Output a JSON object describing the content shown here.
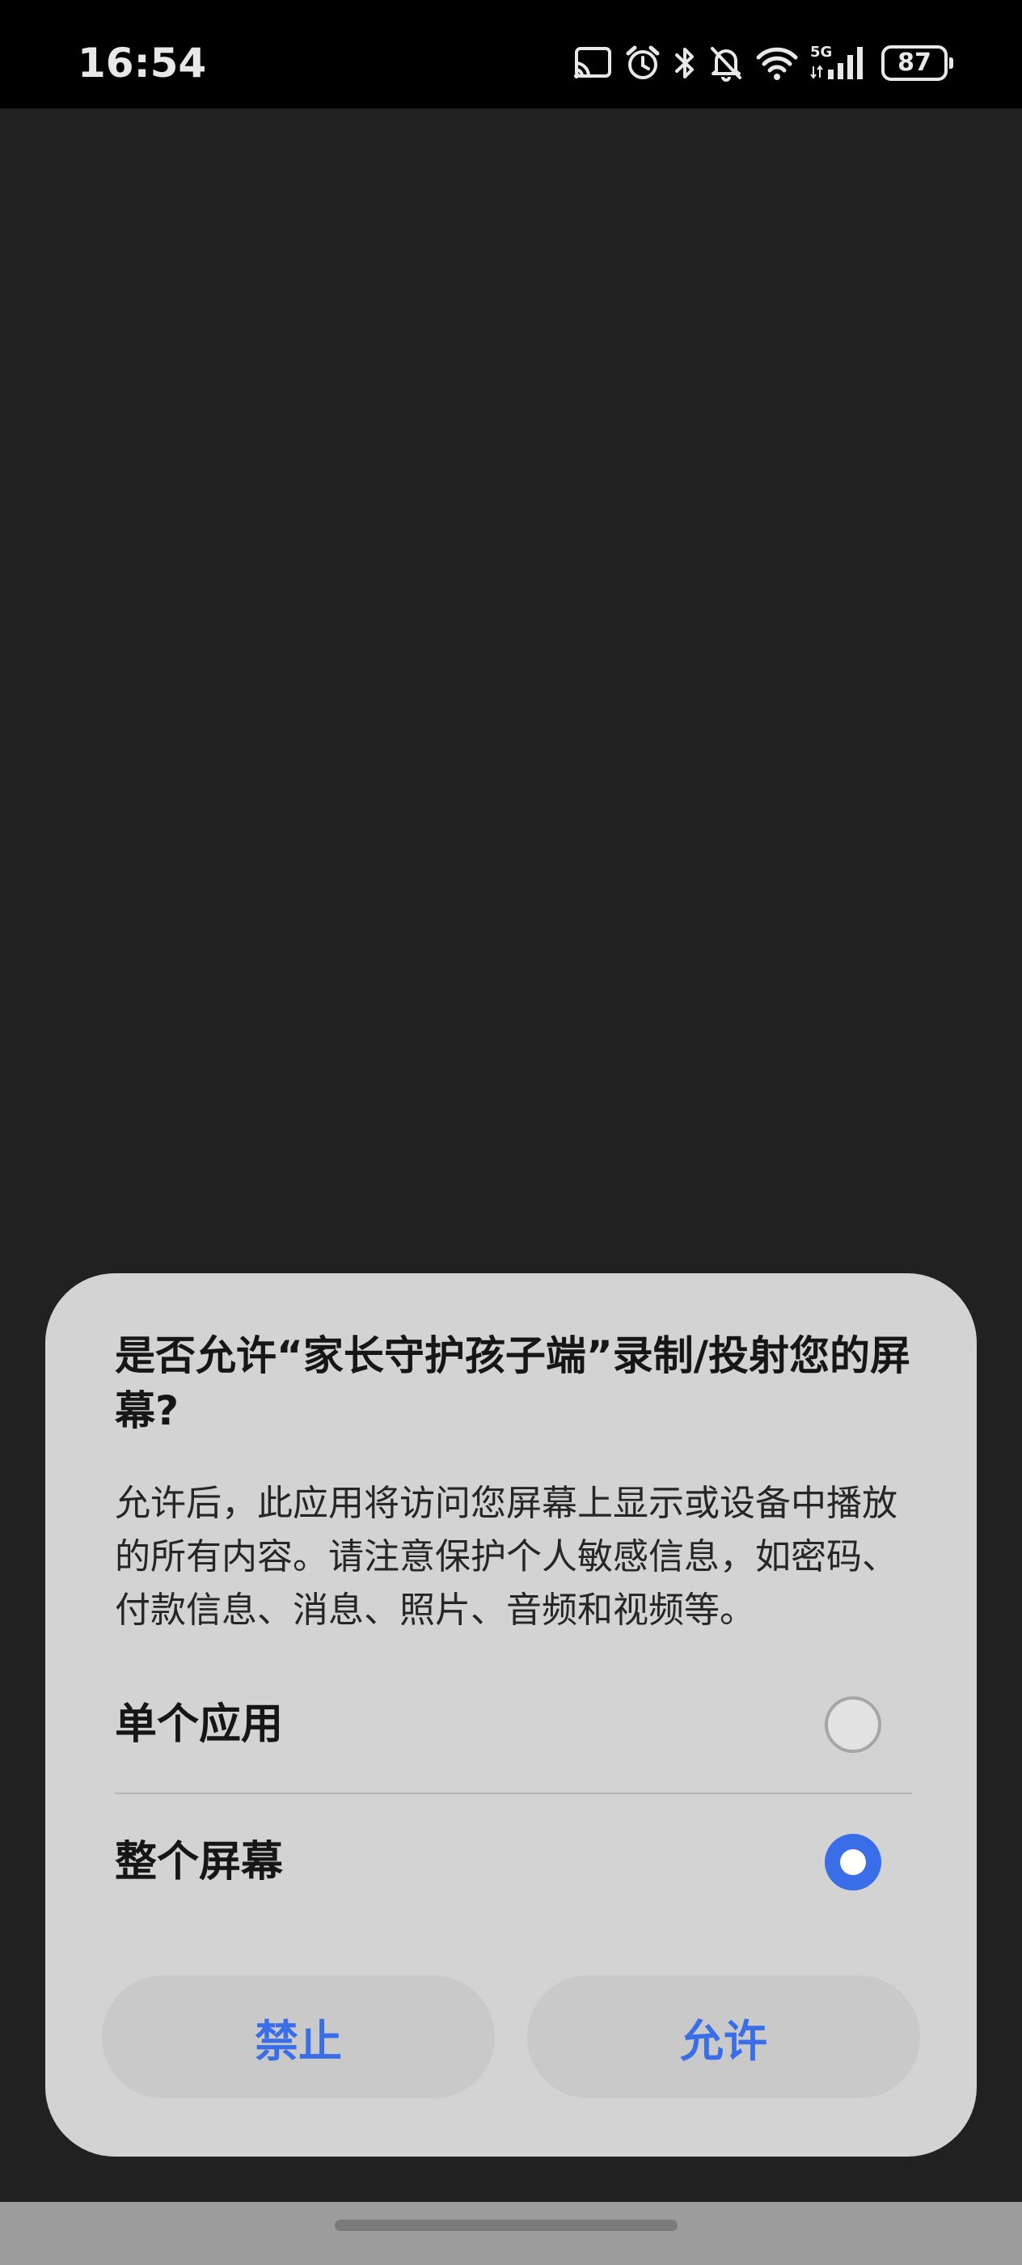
{
  "status_bar": {
    "time": "16:54",
    "network": "5G",
    "battery": "87",
    "icons": [
      "screen-cast-icon",
      "alarm-icon",
      "bluetooth-icon",
      "notifications-muted-icon",
      "wifi-icon",
      "cellular-5g-icon",
      "battery-icon"
    ]
  },
  "dialog": {
    "title": "是否允许“家长守护孩子端”录制/投射您的屏幕?",
    "body": "允许后，此应用将访问您屏幕上显示或设备中播放的所有内容。请注意保护个人敏感信息，如密码、付款信息、消息、照片、音频和视频等。",
    "options": [
      {
        "label": "单个应用",
        "selected": false
      },
      {
        "label": "整个屏幕",
        "selected": true
      }
    ],
    "buttons": {
      "deny": "禁止",
      "allow": "允许"
    },
    "accent_color": "#3a6ee8"
  }
}
